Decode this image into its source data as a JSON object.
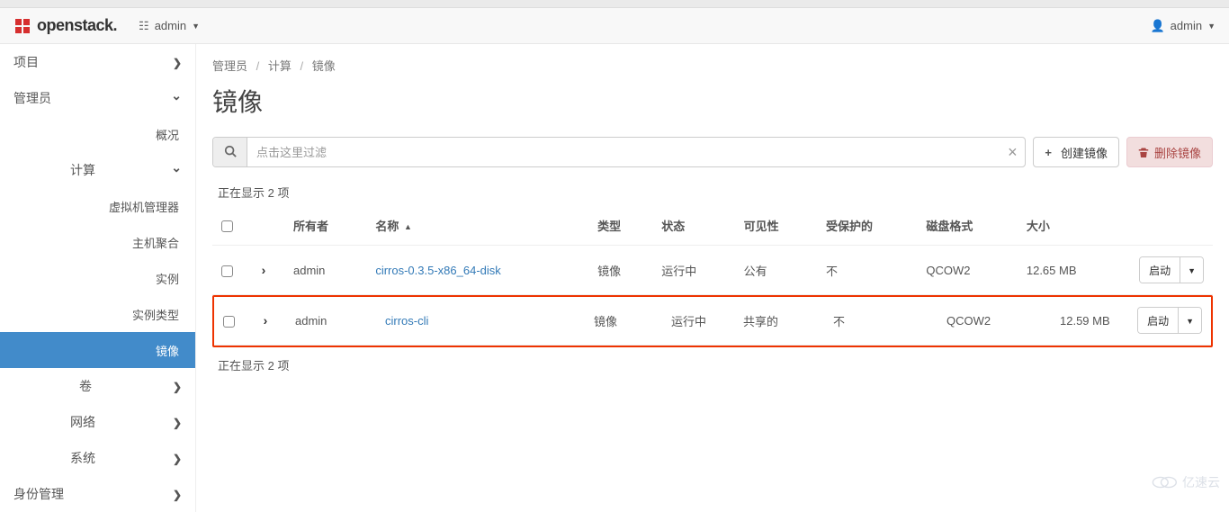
{
  "brand": {
    "name": "openstack."
  },
  "navbar": {
    "project_label": "admin",
    "user_label": "admin"
  },
  "sidebar": {
    "groups": [
      {
        "key": "project",
        "label": "项目",
        "expanded": false
      },
      {
        "key": "admin",
        "label": "管理员",
        "expanded": true
      },
      {
        "key": "identity",
        "label": "身份管理",
        "expanded": false
      }
    ],
    "admin_items": {
      "overview": "概况",
      "compute": "计算",
      "hypervisors": "虚拟机管理器",
      "aggregates": "主机聚合",
      "instances": "实例",
      "flavors": "实例类型",
      "images": "镜像",
      "volumes": "卷",
      "networks": "网络",
      "system": "系统"
    }
  },
  "breadcrumb": {
    "admin": "管理员",
    "compute": "计算",
    "images": "镜像"
  },
  "page_title": "镜像",
  "search": {
    "placeholder": "点击这里过滤"
  },
  "buttons": {
    "create_image": "创建镜像",
    "delete_image": "删除镜像",
    "launch": "启动"
  },
  "table": {
    "count_text_top": "正在显示 2 项",
    "count_text_bottom": "正在显示 2 项",
    "headers": {
      "owner": "所有者",
      "name": "名称",
      "type": "类型",
      "status": "状态",
      "visibility": "可见性",
      "protected": "受保护的",
      "disk_format": "磁盘格式",
      "size": "大小"
    },
    "rows": [
      {
        "owner": "admin",
        "name": "cirros-0.3.5-x86_64-disk",
        "type": "镜像",
        "status": "运行中",
        "visibility": "公有",
        "protected": "不",
        "disk_format": "QCOW2",
        "size": "12.65 MB"
      },
      {
        "owner": "admin",
        "name": "cirros-cli",
        "type": "镜像",
        "status": "运行中",
        "visibility": "共享的",
        "protected": "不",
        "disk_format": "QCOW2",
        "size": "12.59 MB"
      }
    ]
  },
  "watermark": "亿速云"
}
